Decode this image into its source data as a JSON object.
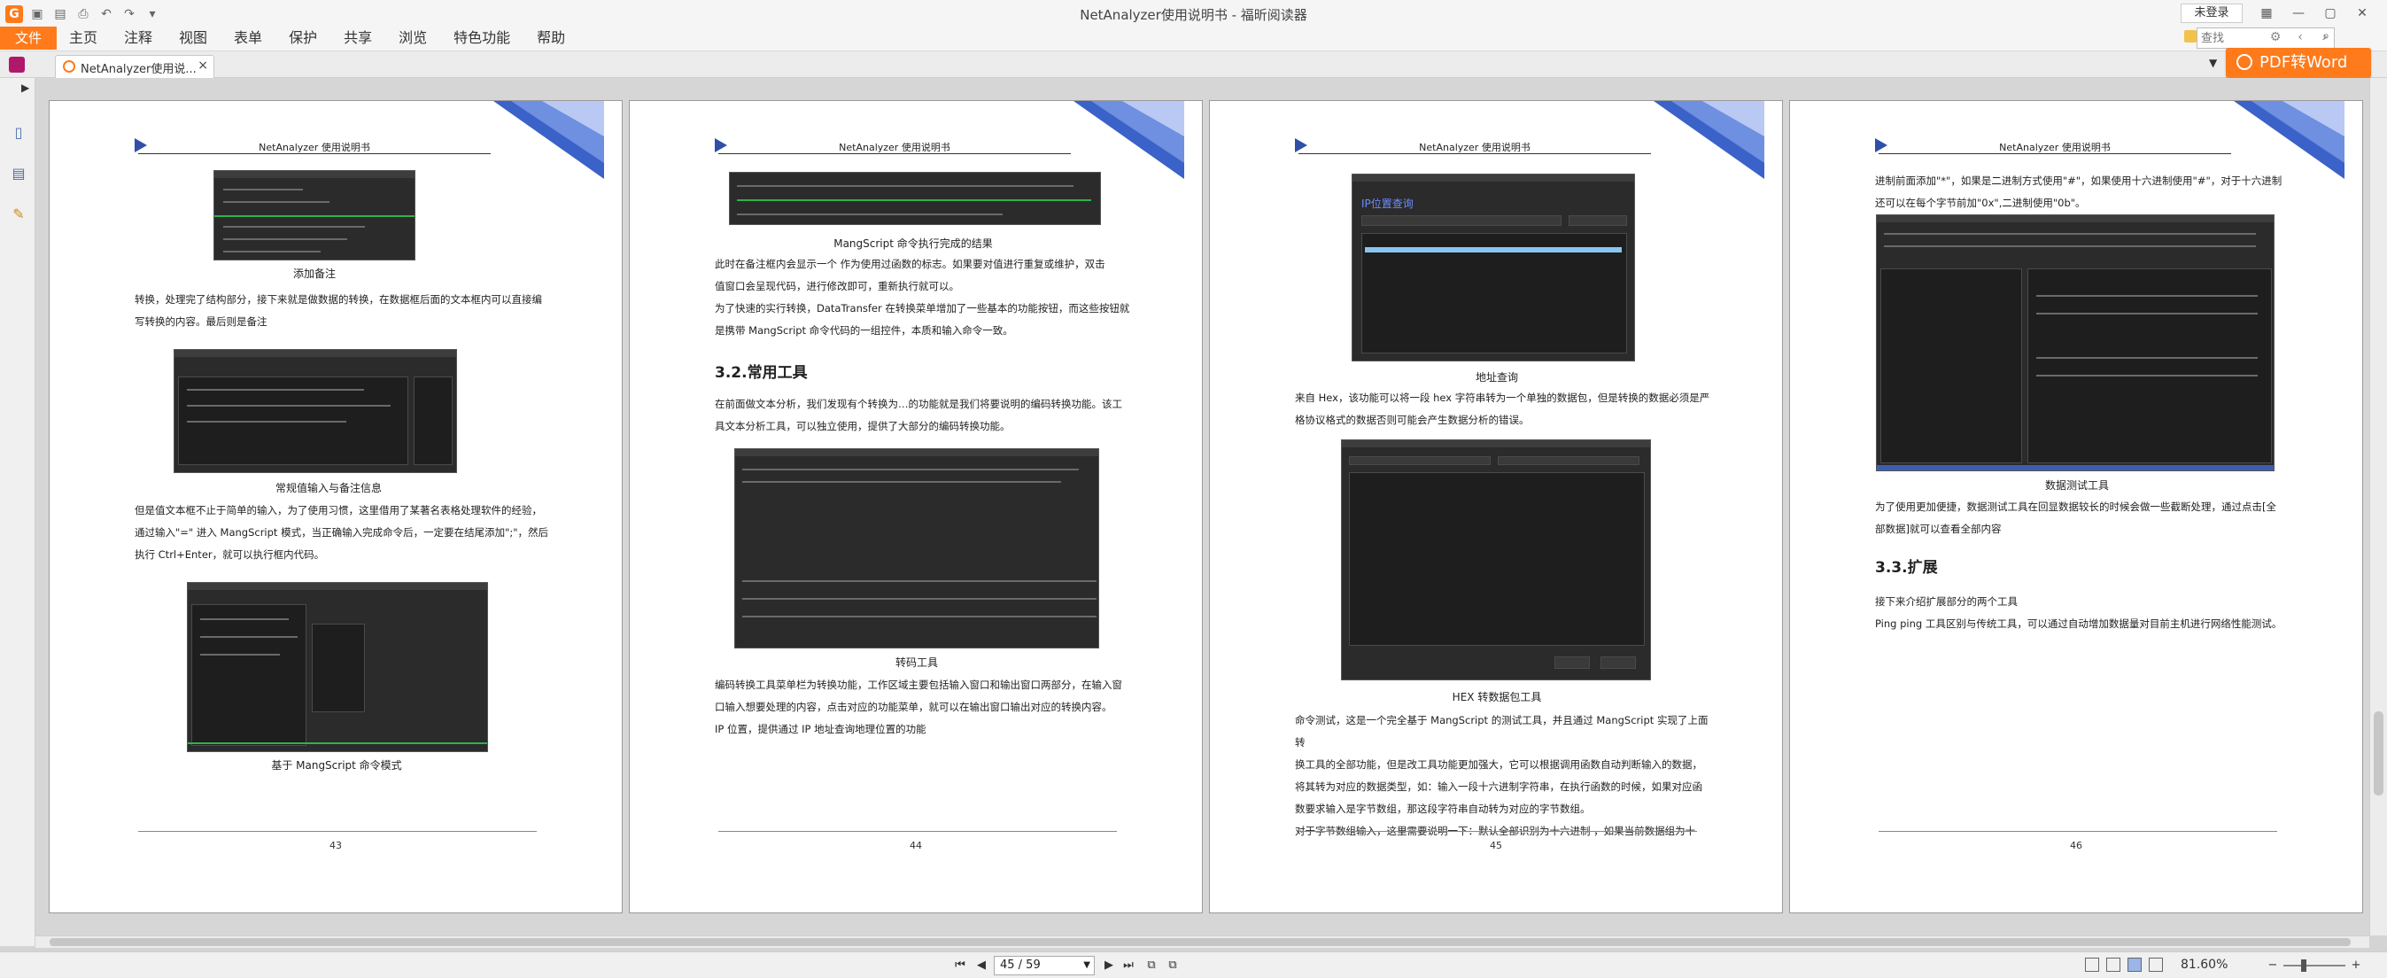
{
  "app": {
    "window_title": "NetAnalyzer使用说明书 - 福昕阅读器",
    "login_label": "未登录",
    "file_menu": "文件",
    "menu": [
      "主页",
      "注释",
      "视图",
      "表单",
      "保护",
      "共享",
      "浏览",
      "特色功能",
      "帮助"
    ],
    "search_placeholder": "查找",
    "pdf_to_word": "PDF转Word"
  },
  "tab": {
    "label": "NetAnalyzer使用说..."
  },
  "pages": [
    {
      "header": "NetAnalyzer 使用说明书",
      "number": "43",
      "captions": [
        "添加备注",
        "常规值输入与备注信息",
        "基于 MangScript 命令模式"
      ],
      "paragraphs": [
        "转换，处理完了结构部分，接下来就是做数据的转换，在数据框后面的文本框内可以直接编",
        "写转换的内容。最后则是备注",
        "但是值文本框不止于简单的输入，为了使用习惯，这里借用了某著名表格处理软件的经验，",
        "通过输入\"=\" 进入 MangScript 模式，当正确输入完成命令后，一定要在结尾添加\";\"，然后",
        "执行 Ctrl+Enter，就可以执行框内代码。"
      ]
    },
    {
      "header": "NetAnalyzer 使用说明书",
      "number": "44",
      "captions": [
        "MangScript 命令执行完成的结果",
        "转码工具"
      ],
      "heading": "3.2.常用工具",
      "paragraphs": [
        "此时在备注框内会显示一个 作为使用过函数的标志。如果要对值进行重复或维护，双击",
        "值窗口会呈现代码，进行修改即可，重新执行就可以。",
        "为了快速的实行转换，DataTransfer 在转换菜单增加了一些基本的功能按钮，而这些按钮就",
        "是携带 MangScript 命令代码的一组控件，本质和输入命令一致。",
        "在前面做文本分析，我们发现有个转换为…的功能就是我们将要说明的编码转换功能。该工",
        "具文本分析工具，可以独立使用，提供了大部分的编码转换功能。",
        "编码转换工具菜单栏为转换功能，工作区域主要包括输入窗口和输出窗口两部分，在输入窗",
        "口输入想要处理的内容，点击对应的功能菜单，就可以在输出窗口输出对应的转换内容。",
        "IP 位置，提供通过 IP 地址查询地理位置的功能"
      ]
    },
    {
      "header": "NetAnalyzer 使用说明书",
      "number": "45",
      "captions": [
        "地址查询",
        "HEX 转数据包工具"
      ],
      "shot_title": "IP位置查询",
      "paragraphs": [
        "来自 Hex，该功能可以将一段 hex 字符串转为一个单独的数据包，但是转换的数据必须是严",
        "格协议格式的数据否则可能会产生数据分析的错误。",
        "命令测试，这是一个完全基于 MangScript 的测试工具，并且通过 MangScript 实现了上面转",
        "换工具的全部功能，但是改工具功能更加强大，它可以根据调用函数自动判断输入的数据，",
        "将其转为对应的数据类型，如：输入一段十六进制字符串，在执行函数的时候，如果对应函",
        "数要求输入是字节数组，那这段字符串自动转为对应的字节数组。",
        "对于字节数组输入，这里需要说明一下：默认全部识别为十六进制 ，如果当前数据组为十"
      ]
    },
    {
      "header": "NetAnalyzer 使用说明书",
      "number": "46",
      "captions": [
        "数据测试工具"
      ],
      "heading": "3.3.扩展",
      "paragraphs": [
        "进制前面添加\"*\"，如果是二进制方式使用\"#\"，如果使用十六进制使用\"#\"，对于十六进制",
        "还可以在每个字节前加\"0x\",二进制使用\"0b\"。",
        "为了使用更加便捷，数据测试工具在回显数据较长的时候会做一些截断处理，通过点击[全",
        "部数据]就可以查看全部内容",
        "接下来介绍扩展部分的两个工具",
        "Ping ping 工具区别与传统工具，可以通过自动增加数据量对目前主机进行网络性能测试。"
      ]
    }
  ],
  "status": {
    "page_indicator": "45 / 59",
    "zoom": "81.60%"
  }
}
